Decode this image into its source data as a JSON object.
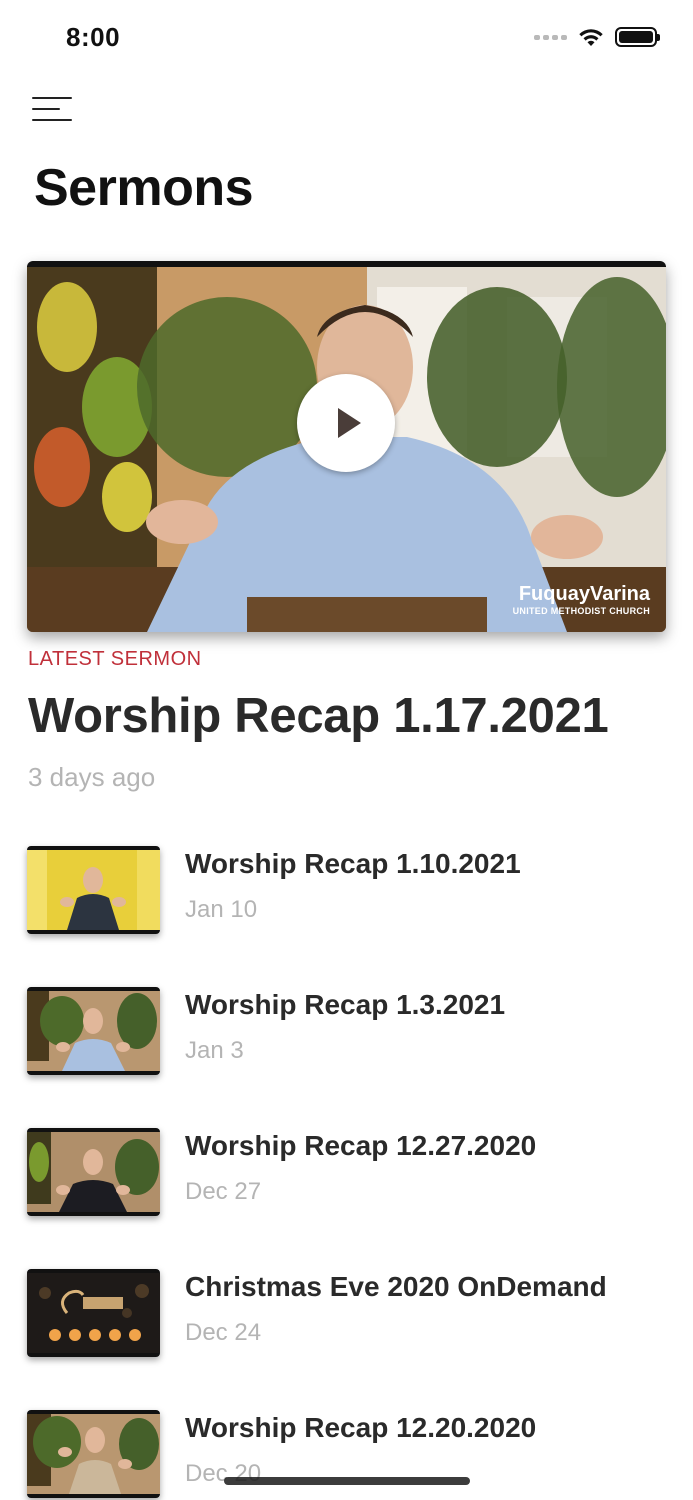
{
  "status_bar": {
    "time": "8:00",
    "icons": [
      "signal-icon",
      "wifi-icon",
      "battery-icon"
    ]
  },
  "header": {
    "menu_icon": "hamburger-menu-icon",
    "title": "Sermons"
  },
  "featured": {
    "label": "LATEST SERMON",
    "title": "Worship Recap 1.17.2021",
    "date": "3 days ago",
    "play_icon": "play-icon",
    "watermark_name": "FuquayVarina",
    "watermark_sub": "UNITED METHODIST CHURCH"
  },
  "sermons": [
    {
      "title": "Worship Recap 1.10.2021",
      "date": "Jan 10"
    },
    {
      "title": "Worship Recap 1.3.2021",
      "date": "Jan 3"
    },
    {
      "title": "Worship Recap 12.27.2020",
      "date": "Dec 27"
    },
    {
      "title": "Christmas Eve 2020 OnDemand",
      "date": "Dec 24"
    },
    {
      "title": "Worship Recap 12.20.2020",
      "date": "Dec 20"
    }
  ],
  "colors": {
    "accent": "#c0303a",
    "title_text": "#2a2a2a",
    "muted_text": "#b4b4b4"
  }
}
